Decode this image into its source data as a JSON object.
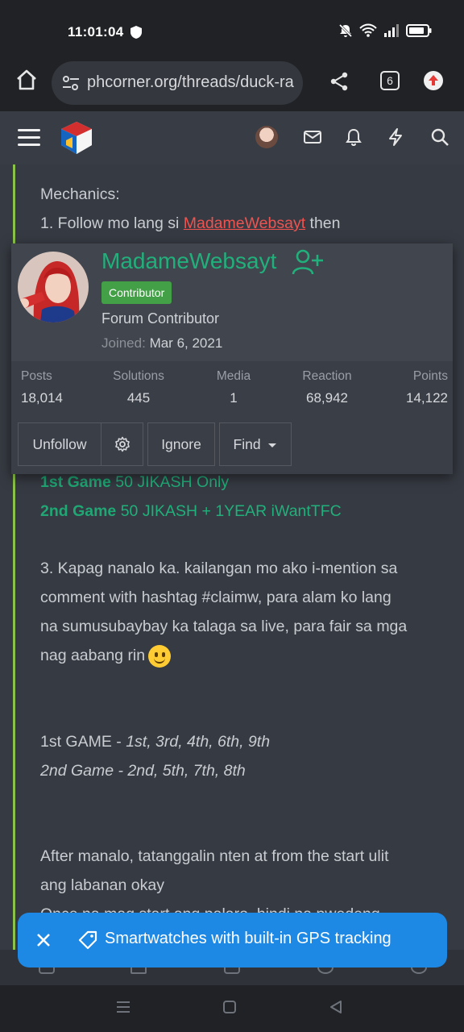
{
  "status": {
    "time": "11:01:04",
    "icons": [
      "shield-icon",
      "mute-icon",
      "wifi-icon",
      "signal-icon",
      "battery-icon"
    ]
  },
  "browser": {
    "url": "phcorner.org/threads/duck-ra",
    "tab_count": "6"
  },
  "site_header": {
    "icons": [
      "menu-icon",
      "site-logo",
      "avatar",
      "mail-icon",
      "bell-icon",
      "bolt-icon",
      "search-icon"
    ]
  },
  "post": {
    "mechanics_label": "Mechanics:",
    "step1_prefix": "1. Follow mo lang si ",
    "step1_link": "MadameWebsayt",
    "step1_suffix": " then",
    "game1_label": "1st Game",
    "game1_prize": " 50 JIKASH Only",
    "game2_label": "2nd Game",
    "game2_prize": " 50 JIKASH + 1YEAR iWantTFC",
    "step3_line1": "3. Kapag nanalo ka. kailangan mo ako i-mention sa",
    "step3_line2": "comment with hashtag #claimw, para alam ko lang",
    "step3_line3": "na sumusubaybay ka talaga sa live, para fair sa mga",
    "step3_line4": "nag aabang rin",
    "sched1_label": "1st GAME - ",
    "sched1_days": "1st, 3rd, 4th, 6th, 9th",
    "sched2": "2nd Game - 2nd, 5th, 7th, 8th",
    "after_line1": "After manalo, tatanggalin nten at from the start ulit",
    "after_line2": "ang labanan okay",
    "after_line3": "Once na mag start ang palaro, hindi na pwedeng"
  },
  "member_card": {
    "username": "MadameWebsayt",
    "badge": "Contributor",
    "user_title": "Forum Contributor",
    "joined_label": "Joined:",
    "joined_date": "Mar 6, 2021",
    "stats": [
      {
        "label": "Posts",
        "value": "18,014"
      },
      {
        "label": "Solutions",
        "value": "445"
      },
      {
        "label": "Media",
        "value": "1"
      },
      {
        "label": "Reaction",
        "value": "68,942"
      },
      {
        "label": "Points",
        "value": "14,122"
      }
    ],
    "buttons": {
      "unfollow": "Unfollow",
      "ignore": "Ignore",
      "find": "Find"
    }
  },
  "toast": {
    "message": "Smartwatches with built-in GPS tracking"
  },
  "colors": {
    "accent_green": "#21b07b",
    "link_red": "#ef5350",
    "toast_blue": "#1e88e5",
    "badge_green": "#43a047",
    "quote_line": "#8bc34a"
  }
}
